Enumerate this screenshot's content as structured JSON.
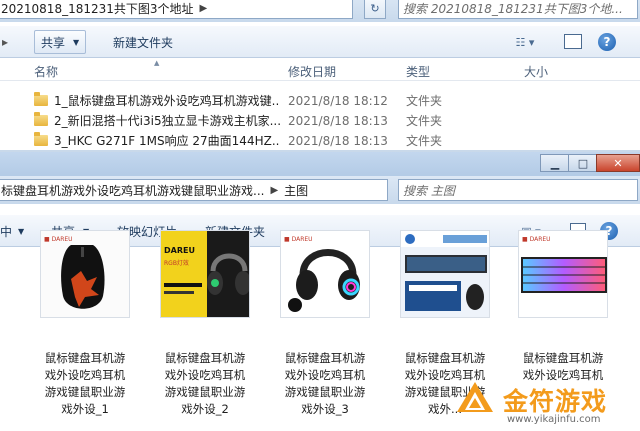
{
  "back_window": {
    "address": {
      "path": "20210818_181231共下图3个地址",
      "sep": "▶"
    },
    "search": {
      "placeholder": "搜索 20210818_181231共下图3个地..."
    },
    "toolbar": {
      "share": "共享",
      "new_folder": "新建文件夹"
    },
    "columns": {
      "name": "名称",
      "modified": "修改日期",
      "type": "类型",
      "size": "大小"
    },
    "files": [
      {
        "name": "1_鼠标键盘耳机游戏外设吃鸡耳机游戏键...",
        "date": "2021/8/18 18:12",
        "type": "文件夹"
      },
      {
        "name": "2_新旧混搭十代i3i5独立显卡游戏主机家...",
        "date": "2021/8/18 18:13",
        "type": "文件夹"
      },
      {
        "name": "3_HKC G271F 1MS响应 27曲面144HZ...",
        "date": "2021/8/18 18:13",
        "type": "文件夹"
      }
    ]
  },
  "front_window": {
    "address": {
      "path": "标键盘耳机游戏外设吃鸡耳机游戏键鼠职业游戏...",
      "sep": "▶",
      "folder": "主图"
    },
    "search": {
      "placeholder": "搜索 主图"
    },
    "toolbar": {
      "left_cut": "中",
      "share": "共享",
      "slideshow": "放映幻灯片",
      "new_folder": "新建文件夹"
    },
    "items": [
      {
        "caption": "鼠标键盘耳机游戏外设吃鸡耳机游戏键鼠职业游戏外设_1",
        "lines": [
          "鼠标键盘耳机游",
          "戏外设吃鸡耳机",
          "游戏键鼠职业游",
          "戏外设_1"
        ]
      },
      {
        "caption": "鼠标键盘耳机游戏外设吃鸡耳机游戏键鼠职业游戏外设_2",
        "lines": [
          "鼠标键盘耳机游",
          "戏外设吃鸡耳机",
          "游戏键鼠职业游",
          "戏外设_2"
        ],
        "thumb_text": "DAREU",
        "thumb_sub": "RGB灯效"
      },
      {
        "caption": "鼠标键盘耳机游戏外设吃鸡耳机游戏键鼠职业游戏外设_3",
        "lines": [
          "鼠标键盘耳机游",
          "戏外设吃鸡耳机",
          "游戏键鼠职业游",
          "戏外设_3"
        ]
      },
      {
        "caption": "鼠标键盘耳机游戏外设吃鸡耳机游戏键鼠职业游戏外设_4",
        "lines": [
          "鼠标键盘耳机游",
          "戏外设吃鸡耳机",
          "游戏键鼠职业游",
          "戏外..."
        ]
      },
      {
        "caption": "鼠标键盘耳机游戏外设吃鸡耳机游戏键鼠职业游戏外设_5",
        "lines": [
          "鼠标键盘耳机游",
          "戏外设吃鸡耳机",
          "",
          ""
        ]
      }
    ]
  },
  "watermark": {
    "title": "金符游戏",
    "url": "www.yikajinfu.com"
  },
  "colors": {
    "toolbar_text": "#1e3b5e",
    "folder": "#e8b53e",
    "watermark": "#f39b1c"
  }
}
